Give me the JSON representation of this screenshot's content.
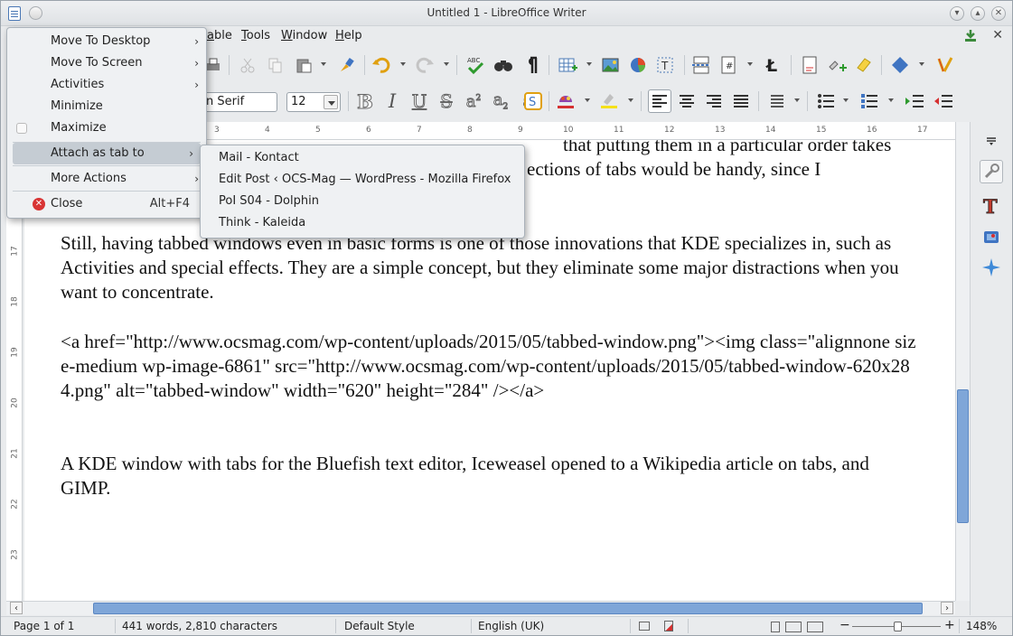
{
  "window": {
    "title": "Untitled 1 - LibreOffice Writer"
  },
  "menubar": {
    "items": [
      {
        "label": "Table",
        "visible": "able"
      },
      {
        "label": "Tools"
      },
      {
        "label": "Window"
      },
      {
        "label": "Help"
      }
    ]
  },
  "toolbar2": {
    "font_name": "n Serif",
    "font_size": "12"
  },
  "ruler": {
    "ticks": [
      "3",
      "4",
      "5",
      "6",
      "7",
      "8",
      "9",
      "10",
      "11",
      "12",
      "13",
      "14",
      "15",
      "16",
      "17"
    ]
  },
  "vruler": {
    "ticks": [
      "17",
      "18",
      "19",
      "20",
      "21",
      "22",
      "23"
    ]
  },
  "document": {
    "partial_line_1": "that putting them in a particular order takes",
    "partial_line_2": "ections of tabs would be handy, since I",
    "para1": "Still, having tabbed windows even in basic forms is one of those innovations that KDE specializes in, such as Activities and special effects. They are a simple concept, but they eliminate some major distractions when you want to concentrate.",
    "para2": "<a href=\"http://www.ocsmag.com/wp-content/uploads/2015/05/tabbed-window.png\"><img class=\"alignnone size-medium wp-image-6861\" src=\"http://www.ocsmag.com/wp-content/uploads/2015/05/tabbed-window-620x284.png\" alt=\"tabbed-window\" width=\"620\" height=\"284\" /></a>",
    "para3": "A KDE window with tabs for the Bluefish text editor, Iceweasel opened to a Wikipedia article on tabs, and GIMP."
  },
  "context_menu": {
    "move_to_desktop": "Move To Desktop",
    "move_to_screen": "Move To Screen",
    "activities": "Activities",
    "minimize": "Minimize",
    "maximize": "Maximize",
    "attach_as_tab": "Attach as tab to",
    "more_actions": "More Actions",
    "close": "Close",
    "close_shortcut": "Alt+F4"
  },
  "submenu": {
    "items": [
      "Mail - Kontact",
      "Edit Post ‹ OCS-Mag — WordPress - Mozilla Firefox",
      "PoI S04 - Dolphin",
      "Think - Kaleida"
    ]
  },
  "statusbar": {
    "page": "Page 1 of 1",
    "words": "441 words, 2,810 characters",
    "style": "Default Style",
    "language": "English (UK)",
    "zoom": "148%"
  },
  "colors": {
    "accent": "#7fa6d8",
    "menu_highlight": "#c5ccd3",
    "close_red": "#d83434"
  }
}
